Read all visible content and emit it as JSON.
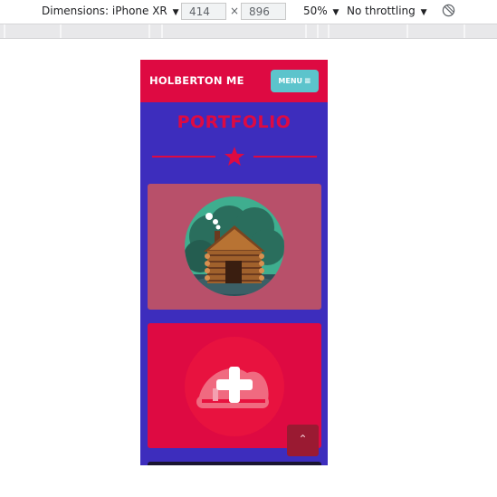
{
  "devtools": {
    "device_label": "Dimensions: iPhone XR",
    "width_value": "414",
    "height_value": "896",
    "times_sign": "×",
    "zoom_label": "50%",
    "throttle_label": "No throttling",
    "caret": "▼",
    "rotate_icon": "rotate-icon"
  },
  "site": {
    "brand": "HOLBERTON ME",
    "menu_label": "MENU",
    "menu_icon": "≡",
    "section_title": "PORTFOLIO",
    "scroll_top_icon": "⌃"
  },
  "portfolio": {
    "items": [
      {
        "image": "log-cabin-icon"
      },
      {
        "image": "add-plus-icon"
      }
    ]
  },
  "colors": {
    "accent": "#de0a42",
    "background": "#3d2dbd",
    "menu_button": "#5cc4cc",
    "card_1": "#b8506a",
    "card_2": "#de0a42"
  }
}
